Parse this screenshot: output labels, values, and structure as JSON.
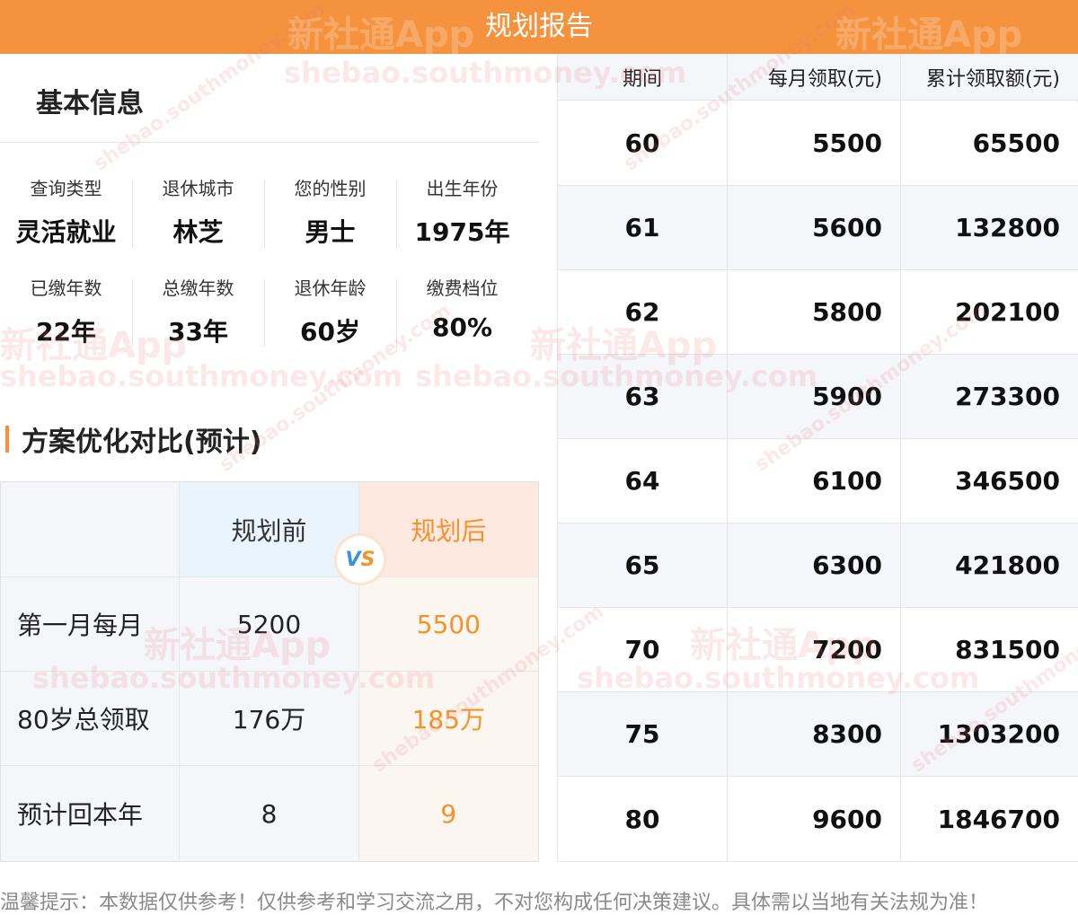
{
  "header": {
    "title": "规划报告"
  },
  "basic_info": {
    "title": "基本信息",
    "row1": [
      {
        "label": "查询类型",
        "value": "灵活就业"
      },
      {
        "label": "退休城市",
        "value": "林芝"
      },
      {
        "label": "您的性别",
        "value": "男士"
      },
      {
        "label": "出生年份",
        "value": "1975年"
      }
    ],
    "row2": [
      {
        "label": "已缴年数",
        "value": "22年"
      },
      {
        "label": "总缴年数",
        "value": "33年"
      },
      {
        "label": "退休年龄",
        "value": "60岁"
      },
      {
        "label": "缴费档位",
        "value": "80%"
      }
    ]
  },
  "comparison": {
    "title": "方案优化对比(预计)",
    "header_before": "规划前",
    "header_after": "规划后",
    "vs_v": "V",
    "vs_s": "S",
    "rows": [
      {
        "label": "第一月每月",
        "before": "5200",
        "after": "5500"
      },
      {
        "label": "80岁总领取",
        "before": "176万",
        "after": "185万"
      },
      {
        "label": "预计回本年",
        "before": "8",
        "after": "9"
      }
    ]
  },
  "schedule": {
    "headers": [
      "期间",
      "每月领取(元)",
      "累计领取额(元)"
    ],
    "rows": [
      {
        "period": "60",
        "monthly": "5500",
        "total": "65500"
      },
      {
        "period": "61",
        "monthly": "5600",
        "total": "132800"
      },
      {
        "period": "62",
        "monthly": "5800",
        "total": "202100"
      },
      {
        "period": "63",
        "monthly": "5900",
        "total": "273300"
      },
      {
        "period": "64",
        "monthly": "6100",
        "total": "346500"
      },
      {
        "period": "65",
        "monthly": "6300",
        "total": "421800"
      },
      {
        "period": "70",
        "monthly": "7200",
        "total": "831500"
      },
      {
        "period": "75",
        "monthly": "8300",
        "total": "1303200"
      },
      {
        "period": "80",
        "monthly": "9600",
        "total": "1846700"
      }
    ]
  },
  "footer": {
    "text": "温馨提示：本数据仅供参考！仅供参考和学习交流之用，不对您构成任何决策建议。具体需以当地有关法规为准！"
  },
  "watermark": {
    "brand": "新社通App",
    "url": "shebao.southmoney.com"
  },
  "colors": {
    "accent": "#f5923e",
    "after_text": "#f5922b",
    "before_header_bg": "#eaf4fd",
    "after_header_bg": "#fde9e0"
  }
}
